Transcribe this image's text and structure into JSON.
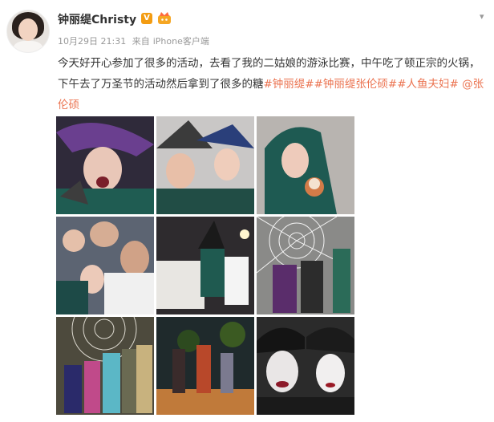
{
  "post": {
    "author": "钟丽缇Christy",
    "verified_badge": "V",
    "time": "10月29日 21:31",
    "source_prefix": "来自",
    "source": "iPhone客户端",
    "text_1": "今天好开心参加了很多的活动，去看了我的二姑娘的游泳比赛，中午吃了顿正宗的火锅，下午去了万圣节的活动然后拿到了很多的糖",
    "topics": [
      "#钟丽缇#",
      "#钟丽缇张伦硕#",
      "#人鱼夫妇#"
    ],
    "mention": "@张伦硕"
  },
  "photos": [
    {
      "label": "halloween-photo-1"
    },
    {
      "label": "halloween-photo-2"
    },
    {
      "label": "halloween-photo-3"
    },
    {
      "label": "halloween-photo-4"
    },
    {
      "label": "halloween-photo-5"
    },
    {
      "label": "halloween-photo-6"
    },
    {
      "label": "halloween-photo-7"
    },
    {
      "label": "halloween-photo-8"
    },
    {
      "label": "halloween-photo-9"
    }
  ],
  "colors": {
    "topic": "#eb7350",
    "meta": "#999999",
    "vip": "#f39c12"
  }
}
